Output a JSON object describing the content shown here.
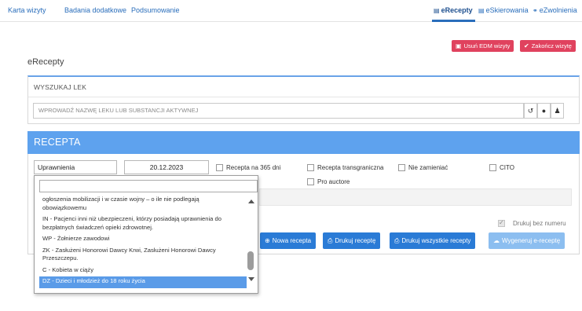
{
  "nav": {
    "tabs": [
      "Karta wizyty",
      "Badania dodatkowe",
      "Podsumowanie"
    ],
    "right_tabs": [
      "eRecepty",
      "eSkierowania",
      "eZwolnienia"
    ]
  },
  "actions": {
    "delete_edm": "Usuń EDM wizyty",
    "finish_visit": "Zakończ wizytę"
  },
  "section_title": "eRecepty",
  "search": {
    "heading": "WYSZUKAJ LEK",
    "placeholder": "WPROWADŹ NAZWĘ LEKU LUB SUBSTANCJI AKTYWNEJ"
  },
  "recepta": {
    "title": "RECEPTA",
    "uprawnienia": "Uprawnienia",
    "date": "20.12.2023",
    "checkboxes": {
      "recepta_365": "Recepta na 365 dni",
      "transgraniczna": "Recepta transgraniczna",
      "nie_zamieniac": "Nie zamieniać",
      "cito": "CITO",
      "pro_auctore": "Pro auctore",
      "drukuj_bez_numeru": "Drukuj bez numeru"
    },
    "buttons": {
      "nowa": "Nowa recepta",
      "drukuj": "Drukuj receptę",
      "drukuj_wszystkie": "Drukuj wszystkie recepty",
      "wygeneruj": "Wygeneruj e-receptę"
    }
  },
  "dropdown": {
    "options": [
      "ogłoszenia mobilizacji i w czasie wojny – o ile nie podlegają obowiązkowemu",
      "IN - Pacjenci inni niż ubezpieczeni, którzy posiadają uprawnienia do bezpłatnych świadczeń opieki zdrowotnej.",
      "WP - Żołnierze zawodowi",
      "ZK - Zasłużeni Honorowi Dawcy Krwi, Zasłużeni Honorowi Dawcy Przeszczepu.",
      "C - Kobieta w ciąży",
      "DZ - Dzieci i młodzież do 18 roku życia"
    ],
    "selected_index": 5
  },
  "colors": {
    "link_blue": "#2a6ebb",
    "header_blue": "#5ea2ee",
    "button_blue": "#2a7bd6",
    "danger_red": "#e0425e"
  }
}
